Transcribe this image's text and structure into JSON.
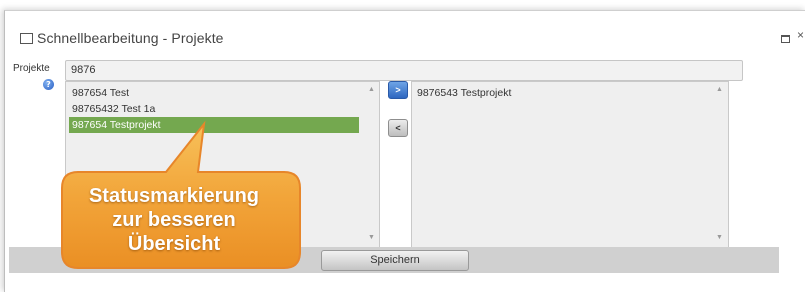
{
  "window": {
    "title": "Schnellbearbeitung - Projekte",
    "restore_icon": "restore-icon",
    "close_glyph": "×"
  },
  "projects": {
    "label": "Projekte",
    "help_icon": "question-icon",
    "help_glyph": "?",
    "search_value": "9876"
  },
  "available_list": {
    "items": [
      "987654 Test",
      "98765432 Test 1a",
      "987654 Testprojekt"
    ],
    "selected_index": 2
  },
  "assigned_list": {
    "items": [
      "9876543 Testprojekt"
    ]
  },
  "buttons": {
    "move_right": ">",
    "move_left": "<",
    "save_label": "Speichern"
  },
  "callout": {
    "lines": [
      "Statusmarkierung",
      "zur besseren",
      "Übersicht"
    ]
  },
  "colors": {
    "selected_row": "#74a84f",
    "callout_fill": "#f0a83a",
    "callout_border": "#e7862a"
  }
}
